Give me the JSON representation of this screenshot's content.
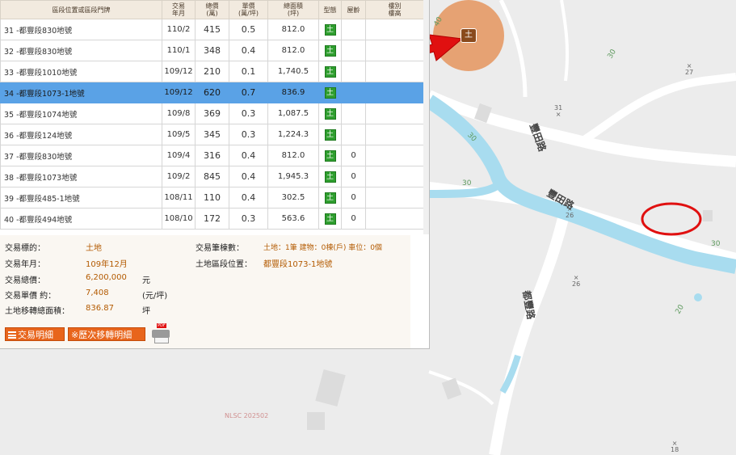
{
  "table": {
    "headers": [
      "區段位置或區段門牌",
      "交易\n年月",
      "總價\n(萬)",
      "單價\n(萬/坪)",
      "總面積\n(坪)",
      "型態",
      "屋齡",
      "樓別\n樓高"
    ],
    "rows": [
      {
        "addr": "31 -都豐段830地號",
        "date": "110/2",
        "total": "415",
        "unit": "0.5",
        "area": "812.0",
        "type": "土",
        "age": "",
        "floor": ""
      },
      {
        "addr": "32 -都豐段830地號",
        "date": "110/1",
        "total": "348",
        "unit": "0.4",
        "area": "812.0",
        "type": "土",
        "age": "",
        "floor": ""
      },
      {
        "addr": "33 -都豐段1010地號",
        "date": "109/12",
        "total": "210",
        "unit": "0.1",
        "area": "1,740.5",
        "type": "土",
        "age": "",
        "floor": ""
      },
      {
        "addr": "34 -都豐段1073-1地號",
        "date": "109/12",
        "total": "620",
        "unit": "0.7",
        "area": "836.9",
        "type": "土",
        "age": "",
        "floor": ""
      },
      {
        "addr": "35 -都豐段1074地號",
        "date": "109/8",
        "total": "369",
        "unit": "0.3",
        "area": "1,087.5",
        "type": "土",
        "age": "",
        "floor": ""
      },
      {
        "addr": "36 -都豐段124地號",
        "date": "109/5",
        "total": "345",
        "unit": "0.3",
        "area": "1,224.3",
        "type": "土",
        "age": "",
        "floor": ""
      },
      {
        "addr": "37 -都豐段830地號",
        "date": "109/4",
        "total": "316",
        "unit": "0.4",
        "area": "812.0",
        "type": "土",
        "age": "0",
        "floor": ""
      },
      {
        "addr": "38 -都豐段1073地號",
        "date": "109/2",
        "total": "845",
        "unit": "0.4",
        "area": "1,945.3",
        "type": "土",
        "age": "0",
        "floor": ""
      },
      {
        "addr": "39 -都豐段485-1地號",
        "date": "108/11",
        "total": "110",
        "unit": "0.4",
        "area": "302.5",
        "type": "土",
        "age": "0",
        "floor": ""
      },
      {
        "addr": "40 -都豐段494地號",
        "date": "108/10",
        "total": "172",
        "unit": "0.3",
        "area": "563.6",
        "type": "土",
        "age": "0",
        "floor": ""
      }
    ],
    "selected_row": 3
  },
  "detail": {
    "target_label": "交易標的：",
    "target_value": "土地",
    "date_label": "交易年月：",
    "date_value": "109年12月",
    "total_label": "交易總價：",
    "total_value": "6,200,000",
    "total_unit": "元",
    "unit_label": "交易單價 約：",
    "unit_value": "7,408",
    "unit_unit": "(元/坪)",
    "area_label": "土地移轉總面積：",
    "area_value": "836.87",
    "area_unit": "坪",
    "count_label": "交易筆棟數：",
    "count_value": "土地：1筆 建物：0棟(戶) 車位：0個",
    "location_label": "土地區段位置：",
    "location_value": "都豐段1073-1地號"
  },
  "buttons": {
    "detail": "交易明細",
    "history": "※歷次移轉明細",
    "pdf": "PDF"
  },
  "map": {
    "marker_label": "土",
    "road_names": [
      "豐田路",
      "豐田路",
      "都豐路"
    ],
    "contours": [
      "40",
      "30",
      "30",
      "30",
      "30",
      "20"
    ],
    "spot_heights": [
      "27",
      "31",
      "26",
      "26",
      "18"
    ],
    "watermark": "NLSC 202502"
  },
  "colors": {
    "selection": "#5aa2e6",
    "accent_orange": "#e8651c",
    "land_green": "#2f9e2f",
    "river": "#a8dcef",
    "arrow_red": "#e01010"
  }
}
